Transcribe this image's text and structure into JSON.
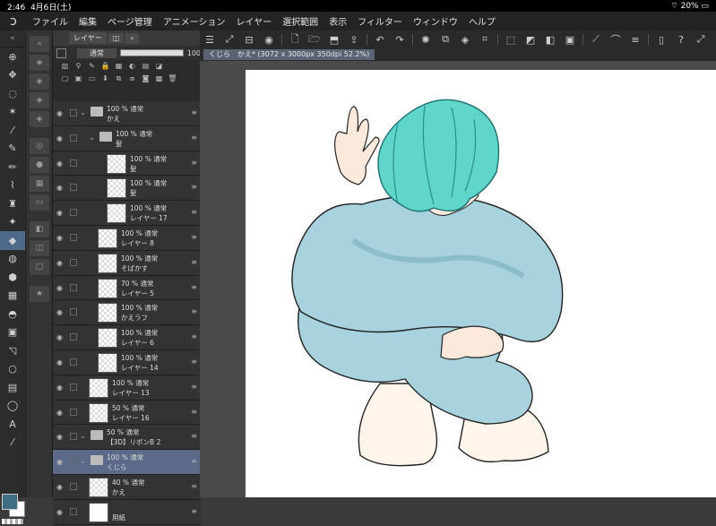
{
  "status": {
    "time": "2:46",
    "date": "4月6日(土)",
    "battery": "20%"
  },
  "menu": [
    "ファイル",
    "編集",
    "ページ管理",
    "アニメーション",
    "レイヤー",
    "選択範囲",
    "表示",
    "フィルター",
    "ウィンドウ",
    "ヘルプ"
  ],
  "layer_panel": {
    "tab": "レイヤー",
    "blend_mode": "通常",
    "opacity": "100"
  },
  "document_tab": "くじら　かえ* (3072 x 3000px 350dpi 52.2%)",
  "layers": [
    {
      "line1": "100 % 通常",
      "line2": "かえ",
      "kind": "folder",
      "indent": 0,
      "selected": false
    },
    {
      "line1": "100 % 通常",
      "line2": "髪",
      "kind": "folder",
      "indent": 1,
      "selected": false
    },
    {
      "line1": "100 % 通常",
      "line2": "髪",
      "kind": "raster",
      "indent": 2,
      "selected": false
    },
    {
      "line1": "100 % 通常",
      "line2": "髪",
      "kind": "raster",
      "indent": 2,
      "selected": false
    },
    {
      "line1": "100 % 通常",
      "line2": "レイヤー 17",
      "kind": "raster",
      "indent": 2,
      "selected": false
    },
    {
      "line1": "100 % 通常",
      "line2": "レイヤー 8",
      "kind": "raster",
      "indent": 1,
      "selected": false
    },
    {
      "line1": "100 % 通常",
      "line2": "そばかす",
      "kind": "raster",
      "indent": 1,
      "selected": false
    },
    {
      "line1": "70 % 通常",
      "line2": "レイヤー 5",
      "kind": "raster",
      "indent": 1,
      "selected": false
    },
    {
      "line1": "100 % 通常",
      "line2": "かえラフ",
      "kind": "raster",
      "indent": 1,
      "selected": false
    },
    {
      "line1": "100 % 通常",
      "line2": "レイヤー 6",
      "kind": "raster",
      "indent": 1,
      "selected": false
    },
    {
      "line1": "100 % 通常",
      "line2": "レイヤー 14",
      "kind": "raster",
      "indent": 1,
      "selected": false
    },
    {
      "line1": "100 % 通常",
      "line2": "レイヤー 13",
      "kind": "raster",
      "indent": 0,
      "selected": false
    },
    {
      "line1": "50 % 通常",
      "line2": "レイヤー 16",
      "kind": "raster",
      "indent": 0,
      "selected": false
    },
    {
      "line1": "50 % 通常",
      "line2": "【3D】リボンB 2",
      "kind": "folder",
      "indent": 0,
      "selected": false
    },
    {
      "line1": "100 % 通常",
      "line2": "くじら",
      "kind": "folder",
      "indent": 0,
      "selected": true
    },
    {
      "line1": "40 % 通常",
      "line2": "かえ",
      "kind": "raster",
      "indent": 0,
      "selected": false
    },
    {
      "line1": "",
      "line2": "用紙",
      "kind": "paper",
      "indent": 0,
      "selected": false
    }
  ],
  "colors": {
    "main_color": "#3f6e82",
    "hair": "#5fd6c9",
    "sweater": "#a7d2de",
    "selected_layer": "#5a6a88"
  }
}
